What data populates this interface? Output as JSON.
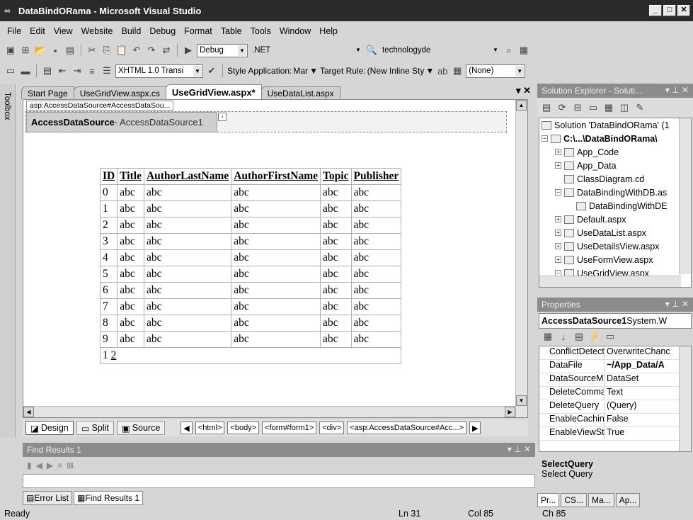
{
  "window": {
    "title": "DataBindORama - Microsoft Visual Studio"
  },
  "menu": [
    "File",
    "Edit",
    "View",
    "Website",
    "Build",
    "Debug",
    "Format",
    "Table",
    "Tools",
    "Window",
    "Help"
  ],
  "toolbar1": {
    "config": "Debug",
    "platform": ".NET",
    "search": "technologyde"
  },
  "toolbar2": {
    "schema": "XHTML 1.0 Transi",
    "style_app_label": "Style Application:",
    "style_app_value": "Mar",
    "target_rule_label": "Target Rule:",
    "target_rule_value": "(New Inline Sty",
    "none_value": "(None)"
  },
  "toolbox_label": "Toolbox",
  "doc_tabs": [
    "Start Page",
    "UseGridView.aspx.cs",
    "UseGridView.aspx*",
    "UseDataList.aspx"
  ],
  "designer": {
    "smart_tag": "asp:AccessDataSource#AccessDataSou...",
    "ads_type": "AccessDataSource",
    "ads_id": " - AccessDataSource1",
    "grid_headers": [
      "ID",
      "Title",
      "AuthorLastName",
      "AuthorFirstName",
      "Topic",
      "Publisher"
    ],
    "grid_rows": [
      [
        "0",
        "abc",
        "abc",
        "abc",
        "abc",
        "abc"
      ],
      [
        "1",
        "abc",
        "abc",
        "abc",
        "abc",
        "abc"
      ],
      [
        "2",
        "abc",
        "abc",
        "abc",
        "abc",
        "abc"
      ],
      [
        "3",
        "abc",
        "abc",
        "abc",
        "abc",
        "abc"
      ],
      [
        "4",
        "abc",
        "abc",
        "abc",
        "abc",
        "abc"
      ],
      [
        "5",
        "abc",
        "abc",
        "abc",
        "abc",
        "abc"
      ],
      [
        "6",
        "abc",
        "abc",
        "abc",
        "abc",
        "abc"
      ],
      [
        "7",
        "abc",
        "abc",
        "abc",
        "abc",
        "abc"
      ],
      [
        "8",
        "abc",
        "abc",
        "abc",
        "abc",
        "abc"
      ],
      [
        "9",
        "abc",
        "abc",
        "abc",
        "abc",
        "abc"
      ]
    ],
    "pager_current": "1",
    "pager_next": "2"
  },
  "viewbar": {
    "design": "Design",
    "split": "Split",
    "source": "Source",
    "crumbs": [
      "<html>",
      "<body>",
      "<form#form1>",
      "<div>",
      "<asp:AccessDataSource#Acc...>"
    ]
  },
  "find": {
    "title": "Find Results 1",
    "tab_error": "Error List",
    "tab_find": "Find Results 1"
  },
  "status": {
    "ready": "Ready",
    "ln": "Ln 31",
    "col": "Col 85",
    "ch": "Ch 85"
  },
  "solution": {
    "title": "Solution Explorer - Soluti...",
    "nodes": [
      "Solution 'DataBindORama' (1",
      "C:\\...\\DataBindORama\\",
      "App_Code",
      "App_Data",
      "ClassDiagram.cd",
      "DataBindingWithDB.as",
      "DataBindingWithDE",
      "Default.aspx",
      "UseDataList.aspx",
      "UseDetailsView.aspx",
      "UseFormView.aspx",
      "UseGridView.aspx"
    ]
  },
  "properties": {
    "title": "Properties",
    "object_name": "AccessDataSource1",
    "object_type": " System.W",
    "rows": [
      {
        "name": "ConflictDetect",
        "value": "OverwriteChanc"
      },
      {
        "name": "DataFile",
        "value": "~/App_Data/A"
      },
      {
        "name": "DataSourceM",
        "value": "DataSet"
      },
      {
        "name": "DeleteComma",
        "value": "Text"
      },
      {
        "name": "DeleteQuery",
        "value": "(Query)"
      },
      {
        "name": "EnableCachin",
        "value": "False"
      },
      {
        "name": "EnableViewSt",
        "value": "True"
      }
    ],
    "desc_title": "SelectQuery",
    "desc_text": "Select Query",
    "bottom_tabs": [
      "Pr...",
      "CS...",
      "Ma...",
      "Ap..."
    ]
  }
}
